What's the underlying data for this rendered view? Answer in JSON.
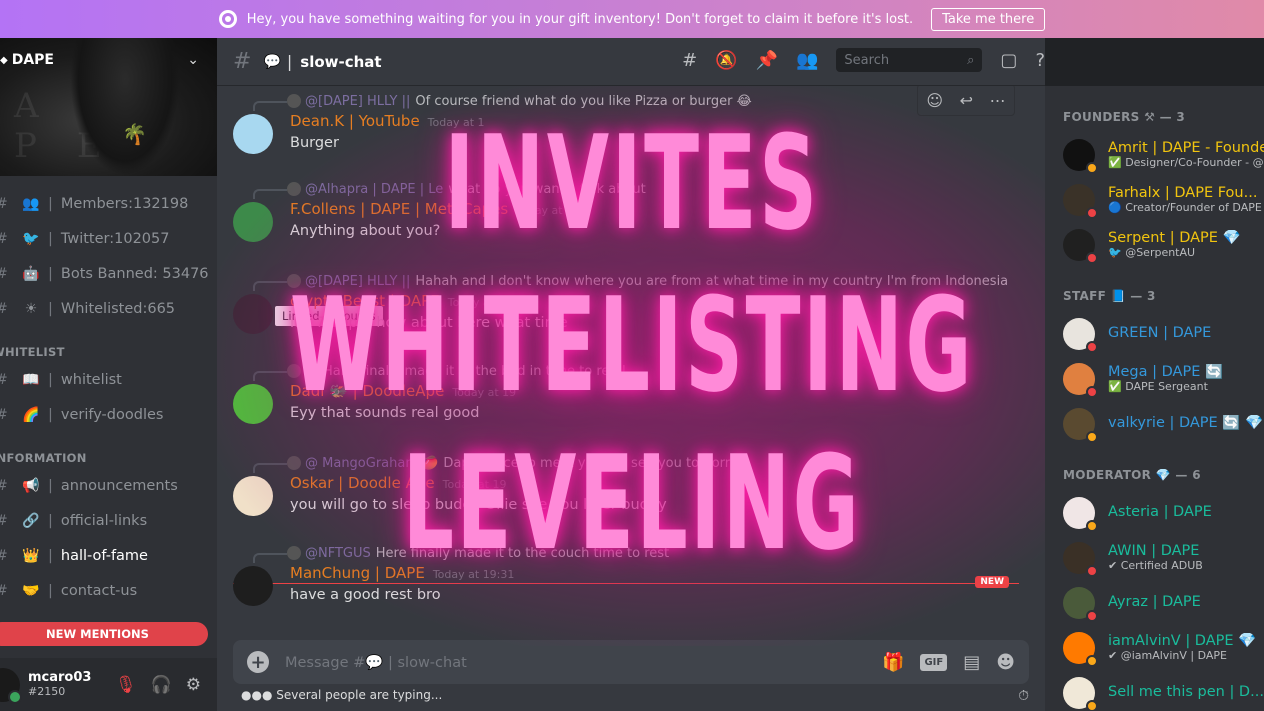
{
  "banner": {
    "message": "Hey, you have something waiting for you in your gift inventory! Don't forget to claim it before it's lost.",
    "button": "Take me there"
  },
  "server": {
    "name": "DAPE",
    "banner_text": "A  PE"
  },
  "stat_channels": [
    {
      "emoji": "👥",
      "label": "Members:132198"
    },
    {
      "emoji": "🐦",
      "label": "Twitter:102057"
    },
    {
      "emoji": "🤖",
      "label": "Bots Banned: 53476"
    },
    {
      "emoji": "☀",
      "label": "Whitelisted:665"
    }
  ],
  "categories": [
    {
      "name": "WHITELIST",
      "channels": [
        {
          "emoji": "📖",
          "label": "whitelist"
        },
        {
          "emoji": "🌈",
          "label": "verify-doodles"
        }
      ]
    },
    {
      "name": "INFORMATION",
      "channels": [
        {
          "emoji": "📢",
          "label": "announcements"
        },
        {
          "emoji": "🔗",
          "label": "official-links"
        },
        {
          "emoji": "👑",
          "label": "hall-of-fame",
          "active": true
        },
        {
          "emoji": "🤝",
          "label": "contact-us"
        }
      ]
    }
  ],
  "new_mentions": "NEW MENTIONS",
  "user": {
    "name": "mcaro03",
    "discriminator": "#2150"
  },
  "channel": {
    "name": "slow-chat",
    "emoji": "💬"
  },
  "search_placeholder": "Search",
  "messages": [
    {
      "reply_mention": "@[DAPE] HLLY ||",
      "reply_text": "Of course friend what do you like Pizza or burger 😂",
      "author": "Dean.K | YouTube",
      "author_color": "#e67e22",
      "time": "Today at 1",
      "text": "Burger",
      "avatar_color": "#a8d8f0"
    },
    {
      "reply_mention": "@Alhapra | DAPE | Le",
      "reply_text": "what do you wanna talk about",
      "author": "F.Collens | DAPE | MetaCapes",
      "author_color": "#e67e22",
      "time": "Today at 10",
      "text": "Anything about you?",
      "avatar_color": "#3d8a4a"
    },
    {
      "reply_mention": "@[DAPE] HLLY ||",
      "reply_text": "Hahah and I don't know where you are from at what time in my country I'm from Indonesia",
      "author": "crypto Beast | DAPE",
      "author_color": "#e67e22",
      "time": "Today at 19",
      "text": "it's 7:30pm how about here what time",
      "avatar_color": "#3a2a36"
    },
    {
      "reply_mention": "@",
      "reply_text": "Haha finally made it to the bed in time to rest!",
      "author": "Dadi 🐲 | DoodleApe",
      "author_color": "#e67e22",
      "time": "Today at 19",
      "text": "Eyy that sounds real good",
      "avatar_color": "#4cc23a"
    },
    {
      "reply_mention": "@ MangoGraham 🥭",
      "reply_text": "Dape | Nice to meet you too see you tomorrow",
      "author": "Oskar | Doodle Ape",
      "author_color": "#e67e22",
      "time": "Today at 19",
      "text": "you will go to sleep buddy Ollie see you later buddy",
      "avatar_color": "#f0e0c8"
    },
    {
      "reply_mention": "@NFTGUS",
      "reply_text": "Here finally made it to the couch time to rest",
      "author": "ManChung | DAPE",
      "author_color": "#e67e22",
      "time": "Today at 19:31",
      "text": "have a good rest bro",
      "avatar_color": "#1e1e1e"
    }
  ],
  "tooltip": "Linked Accounts",
  "new_label": "NEW",
  "composer": {
    "placeholder_prefix": "Message #",
    "placeholder_channel": "slow-chat",
    "gif": "GIF"
  },
  "typing": "Several people are typing...",
  "overlay_lines": [
    "INVITES",
    "WHITELISTING",
    "LEVELING"
  ],
  "member_groups": [
    {
      "title": "FOUNDERS ⚒ — 3",
      "members": [
        {
          "name": "Amrit | DAPE - Founder",
          "status": "✅ Designer/Co-Founder - @a",
          "color": "#f1c40f",
          "presence": "idle",
          "avatar": "#111"
        },
        {
          "name": "Farhalx | DAPE Fou...",
          "status": "🔵 Creator/Founder of DAPE",
          "color": "#f1c40f",
          "presence": "dnd",
          "avatar": "#3a3228"
        },
        {
          "name": "Serpent | DAPE 💎",
          "status": "🐦 @SerpentAU",
          "color": "#f1c40f",
          "presence": "dnd",
          "avatar": "#202020"
        }
      ]
    },
    {
      "title": "STAFF 📘 — 3",
      "members": [
        {
          "name": "GREEN | DAPE",
          "status": "",
          "color": "#3498db",
          "presence": "dnd",
          "avatar": "#e8e4de"
        },
        {
          "name": "Mega | DAPE 🔄",
          "status": "✅ DAPE Sergeant",
          "color": "#3498db",
          "presence": "dnd",
          "avatar": "#e08040"
        },
        {
          "name": "valkyrie | DAPE 🔄 💎",
          "status": "",
          "color": "#3498db",
          "presence": "idle",
          "avatar": "#5a4a30"
        }
      ]
    },
    {
      "title": "MODERATOR 💎 — 6",
      "members": [
        {
          "name": "Asteria | DAPE",
          "status": "",
          "color": "#1abc9c",
          "presence": "idle",
          "avatar": "#f0e6e6"
        },
        {
          "name": "AWIN | DAPE",
          "status": "✔ Certified ADUB",
          "color": "#1abc9c",
          "presence": "dnd",
          "avatar": "#3a3026"
        },
        {
          "name": "Ayraz | DAPE",
          "status": "",
          "color": "#1abc9c",
          "presence": "dnd",
          "avatar": "#4a5a3a"
        },
        {
          "name": "iamAlvinV | DAPE 💎",
          "status": "✔ @iamAlvinV | DAPE",
          "color": "#1abc9c",
          "presence": "idle",
          "avatar": "#ff7a00"
        },
        {
          "name": "Sell me this pen | D...",
          "status": "",
          "color": "#1abc9c",
          "presence": "idle",
          "avatar": "#f0e8d8"
        }
      ]
    }
  ]
}
